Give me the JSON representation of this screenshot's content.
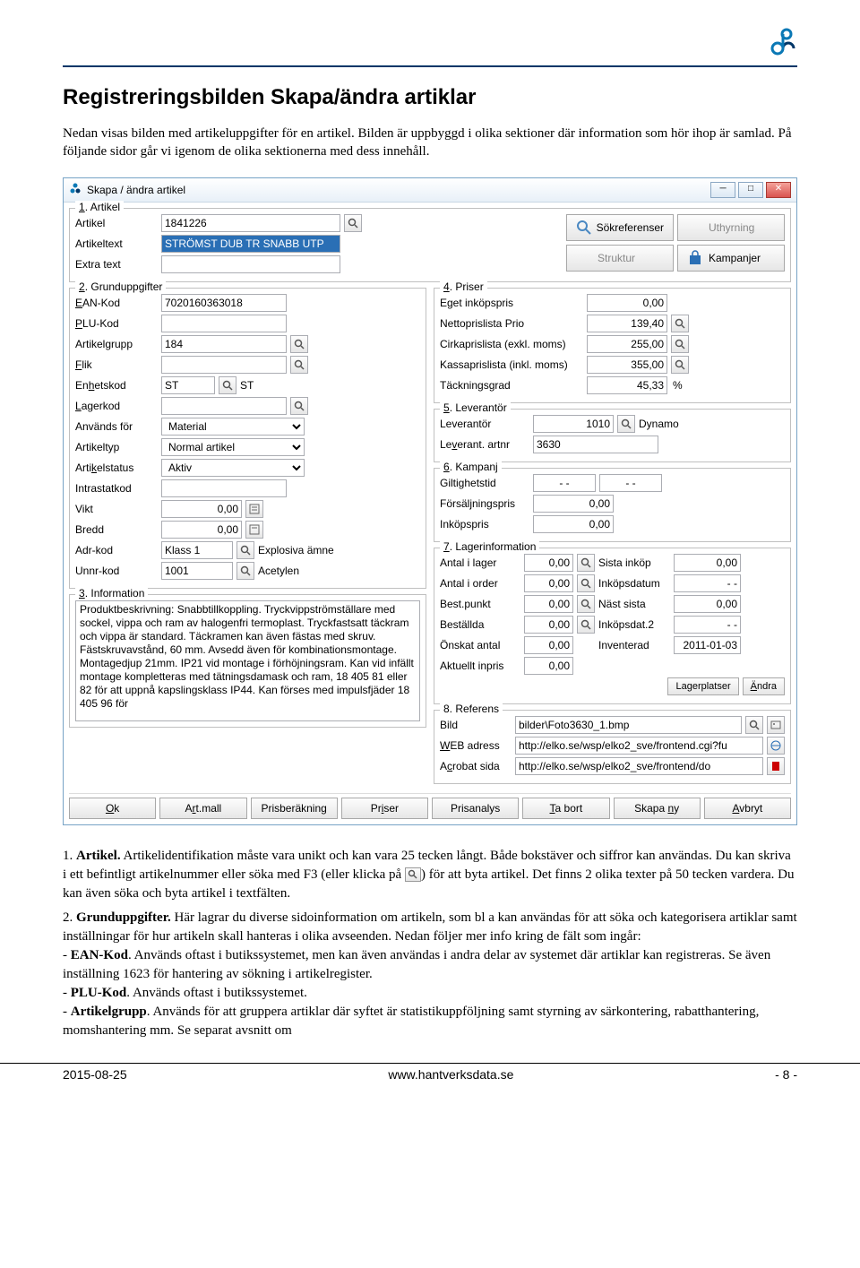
{
  "page_title": "Registreringsbilden Skapa/ändra artiklar",
  "intro": "Nedan visas bilden med artikeluppgifter för en artikel. Bilden är uppbyggd i olika sektioner där information som hör ihop är samlad. På följande sidor går vi igenom de olika sektionerna med dess innehåll.",
  "window": {
    "title": "Skapa / ändra artikel",
    "section1": {
      "legend": "1. Artikel",
      "artikel_label": "Artikel",
      "artikel_value": "1841226",
      "artikeltext_label": "Artikeltext",
      "artikeltext_value": "STRÖMST DUB TR SNABB UTP",
      "extra_label": "Extra text",
      "extra_value": "",
      "btn_sokref": "Sökreferenser",
      "btn_uthyrning": "Uthyrning",
      "btn_struktur": "Struktur",
      "btn_kampanjer": "Kampanjer"
    },
    "section2": {
      "legend": "2. Grunduppgifter",
      "ean_label": "EAN-Kod",
      "ean_value": "7020160363018",
      "plu_label": "PLU-Kod",
      "plu_value": "",
      "artgrupp_label": "Artikelgrupp",
      "artgrupp_value": "184",
      "flik_label": "Flik",
      "flik_value": "",
      "enhet_label": "Enhetskod",
      "enhet_value": "ST",
      "enhet_text": "ST",
      "lager_label": "Lagerkod",
      "lager_value": "",
      "anvands_label": "Används för",
      "anvands_value": "Material",
      "typ_label": "Artikeltyp",
      "typ_value": "Normal artikel",
      "status_label": "Artikelstatus",
      "status_value": "Aktiv",
      "intrastat_label": "Intrastatkod",
      "intrastat_value": "",
      "vikt_label": "Vikt",
      "vikt_value": "0,00",
      "bredd_label": "Bredd",
      "bredd_value": "0,00",
      "adr_label": "Adr-kod",
      "adr_value": "Klass 1",
      "adr_text": "Explosiva ämne",
      "unnr_label": "Unnr-kod",
      "unnr_value": "1001",
      "unnr_text": "Acetylen"
    },
    "section3": {
      "legend": "3. Information",
      "text": "Produktbeskrivning: Snabbtillkoppling. Tryckvippströmställare med sockel, vippa och ram av halogenfri termoplast. Tryckfastsatt täckram och vippa är standard. Täckramen kan även fästas med skruv. Fästskruvavstånd, 60 mm. Avsedd även för kombinationsmontage. Montagedjup 21mm. IP21 vid montage i förhöjningsram. Kan vid infällt montage kompletteras med tätningsdamask och ram, 18 405 81 eller 82 för att uppnå kapslingsklass IP44. Kan förses med impulsfjäder 18 405 96 för"
    },
    "section4": {
      "legend": "4. Priser",
      "items": [
        {
          "label": "Eget inköpspris",
          "value": "0,00",
          "lookup": false
        },
        {
          "label": "Nettoprislista Prio",
          "value": "139,40",
          "lookup": true
        },
        {
          "label": "Cirkaprislista (exkl. moms)",
          "value": "255,00",
          "lookup": true
        },
        {
          "label": "Kassaprislista (inkl. moms)",
          "value": "355,00",
          "lookup": true
        },
        {
          "label": "Täckningsgrad",
          "value": "45,33",
          "suffix": "%"
        }
      ]
    },
    "section5": {
      "legend": "5. Leverantör",
      "lev_label": "Leverantör",
      "lev_value": "1010",
      "lev_name": "Dynamo",
      "artnr_label": "Leverant. artnr",
      "artnr_value": "3630"
    },
    "section6": {
      "legend": "6. Kampanj",
      "gilt_label": "Giltighetstid",
      "gilt_from": "- -",
      "gilt_to": "- -",
      "forsalj_label": "Försäljningspris",
      "forsalj_value": "0,00",
      "inkop_label": "Inköpspris",
      "inkop_value": "0,00"
    },
    "section7": {
      "legend": "7. Lagerinformation",
      "rows": [
        {
          "l1": "Antal i lager",
          "v1": "0,00",
          "lookup": true,
          "l2": "Sista inköp",
          "v2": "0,00"
        },
        {
          "l1": "Antal i order",
          "v1": "0,00",
          "lookup": true,
          "l2": "Inköpsdatum",
          "v2": "- -"
        },
        {
          "l1": "Best.punkt",
          "v1": "0,00",
          "lookup": true,
          "l2": "Näst sista",
          "v2": "0,00"
        },
        {
          "l1": "Beställda",
          "v1": "0,00",
          "lookup": true,
          "l2": "Inköpsdat.2",
          "v2": "- -"
        },
        {
          "l1": "Önskat antal",
          "v1": "0,00",
          "lookup": false,
          "l2": "Inventerad",
          "v2": "2011-01-03"
        },
        {
          "l1": "Aktuellt inpris",
          "v1": "0,00",
          "lookup": false
        }
      ],
      "btn_lagerplatser": "Lagerplatser",
      "btn_andra": "Ändra"
    },
    "section8": {
      "legend": "8. Referens",
      "bild_label": "Bild",
      "bild_value": "bilder\\Foto3630_1.bmp",
      "web_label": "WEB adress",
      "web_value": "http://elko.se/wsp/elko2_sve/frontend.cgi?fu",
      "acrobat_label": "Acrobat sida",
      "acrobat_value": "http://elko.se/wsp/elko2_sve/frontend/do"
    },
    "buttons": {
      "ok": "Ok",
      "artmall": "Art.mall",
      "prisber": "Prisberäkning",
      "priser": "Priser",
      "prisanalys": "Prisanalys",
      "tabort": "Ta bort",
      "skapany": "Skapa ny",
      "avbryt": "Avbryt"
    }
  },
  "list": {
    "item1_pre": "1. ",
    "item1_bold": "Artikel.",
    "item1_a": " Artikelidentifikation måste vara unikt och kan vara 25 tecken långt. Både bokstäver och siffror kan användas. Du kan skriva i ett befintligt artikelnummer eller söka med F3 (eller klicka på ",
    "item1_b": ") för att byta artikel. Det finns 2 olika texter på 50 tecken vardera. Du kan även söka och byta artikel i textfälten.",
    "item2_pre": "2. ",
    "item2_bold": "Grunduppgifter.",
    "item2_text": " Här lagrar du diverse sidoinformation om artikeln, som bl a kan användas för att söka och kategorisera artiklar samt inställningar för hur artikeln skall hanteras i olika avseenden. Nedan följer mer info kring de fält som ingår:",
    "ean_bold": "EAN-Kod",
    "ean_text": ". Används oftast i butikssystemet, men kan även användas i andra delar av systemet där artiklar kan registreras. Se även inställning 1623 för hantering av sökning i artikelregister.",
    "plu_bold": "PLU-Kod",
    "plu_text": ". Används oftast i butikssystemet.",
    "artg_bold": "Artikelgrupp",
    "artg_text": ". Används för att gruppera artiklar där syftet är statistikuppföljning samt styrning av särkontering, rabatthantering, momshantering mm. Se separat avsnitt om"
  },
  "footer": {
    "date": "2015-08-25",
    "url": "www.hantverksdata.se",
    "page": "- 8 -"
  }
}
